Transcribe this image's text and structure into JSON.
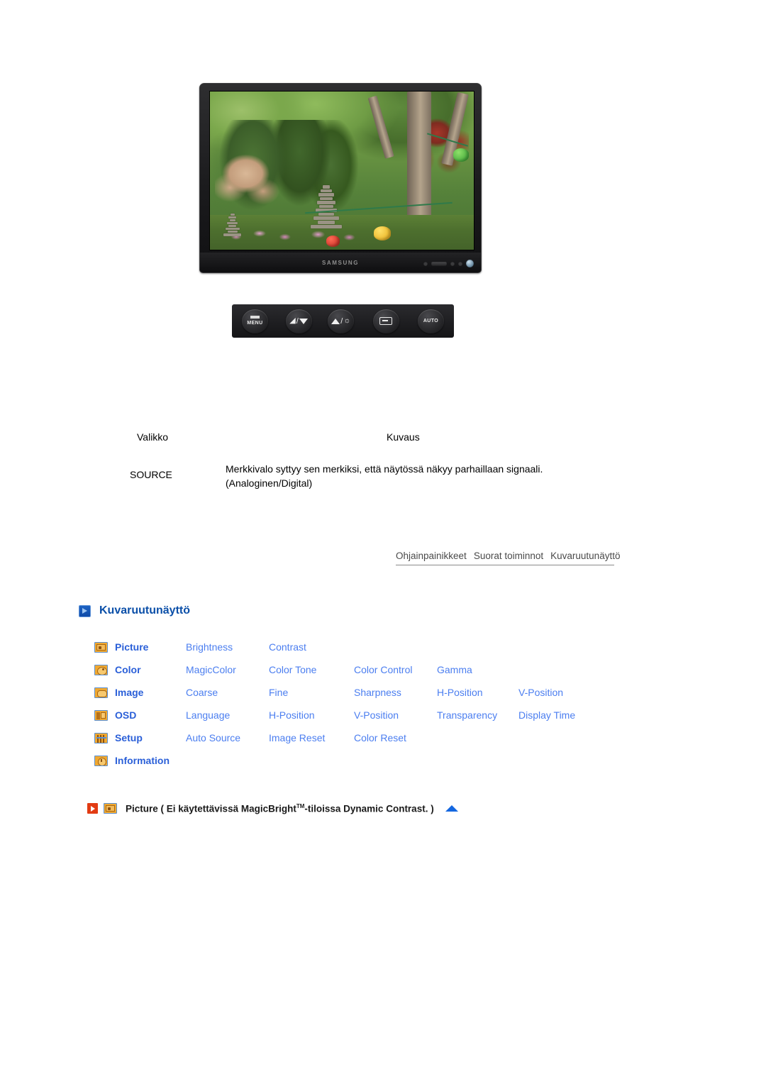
{
  "figure": {
    "monitor_brand": "SAMSUNG",
    "alt_name": "samsung-monitor-garden-photo",
    "buttons": [
      {
        "name": "menu-button",
        "label": "MENU"
      },
      {
        "name": "down-button",
        "label": ""
      },
      {
        "name": "brightness-up-button",
        "label": ""
      },
      {
        "name": "enter-source-button",
        "label": ""
      },
      {
        "name": "auto-button",
        "label": "AUTO"
      }
    ]
  },
  "table": {
    "header_menu": "Valikko",
    "header_description": "Kuvaus",
    "rows": [
      {
        "menu": "SOURCE",
        "description": "Merkkivalo syttyy sen merkiksi, että näytössä näkyy parhaillaan signaali. (Analoginen/Digital)"
      }
    ]
  },
  "nav": {
    "items": [
      "Ohjainpainikkeet",
      "Suorat toiminnot",
      "Kuvaruutunäyttö"
    ]
  },
  "section": {
    "heading": "Kuvaruutunäyttö"
  },
  "osd_menu": {
    "rows": [
      {
        "icon": "picture-icon",
        "category": "Picture",
        "items": [
          "Brightness",
          "Contrast"
        ]
      },
      {
        "icon": "color-icon",
        "category": "Color",
        "items": [
          "MagicColor",
          "Color Tone",
          "Color Control",
          "Gamma"
        ]
      },
      {
        "icon": "image-icon",
        "category": "Image",
        "items": [
          "Coarse",
          "Fine",
          "Sharpness",
          "H-Position",
          "V-Position"
        ]
      },
      {
        "icon": "osd-icon",
        "category": "OSD",
        "items": [
          "Language",
          "H-Position",
          "V-Position",
          "Transparency",
          "Display Time"
        ]
      },
      {
        "icon": "setup-icon",
        "category": "Setup",
        "items": [
          "Auto Source",
          "Image Reset",
          "Color Reset"
        ]
      },
      {
        "icon": "information-icon",
        "category": "Information",
        "items": []
      }
    ]
  },
  "picture_note": {
    "text_before": "Picture ( Ei käytettävissä MagicBright",
    "trademark": "TM",
    "text_after": "-tiloissa Dynamic Contrast. )"
  },
  "colors": {
    "link_blue": "#4b7ef0",
    "category_blue": "#2a5fd8",
    "heading_blue": "#0b4fa8",
    "icon_orange": "#f0a830",
    "icon_border_blue": "#5b91d4",
    "red_arrow": "#e23b13",
    "top_triangle": "#1467e0"
  }
}
